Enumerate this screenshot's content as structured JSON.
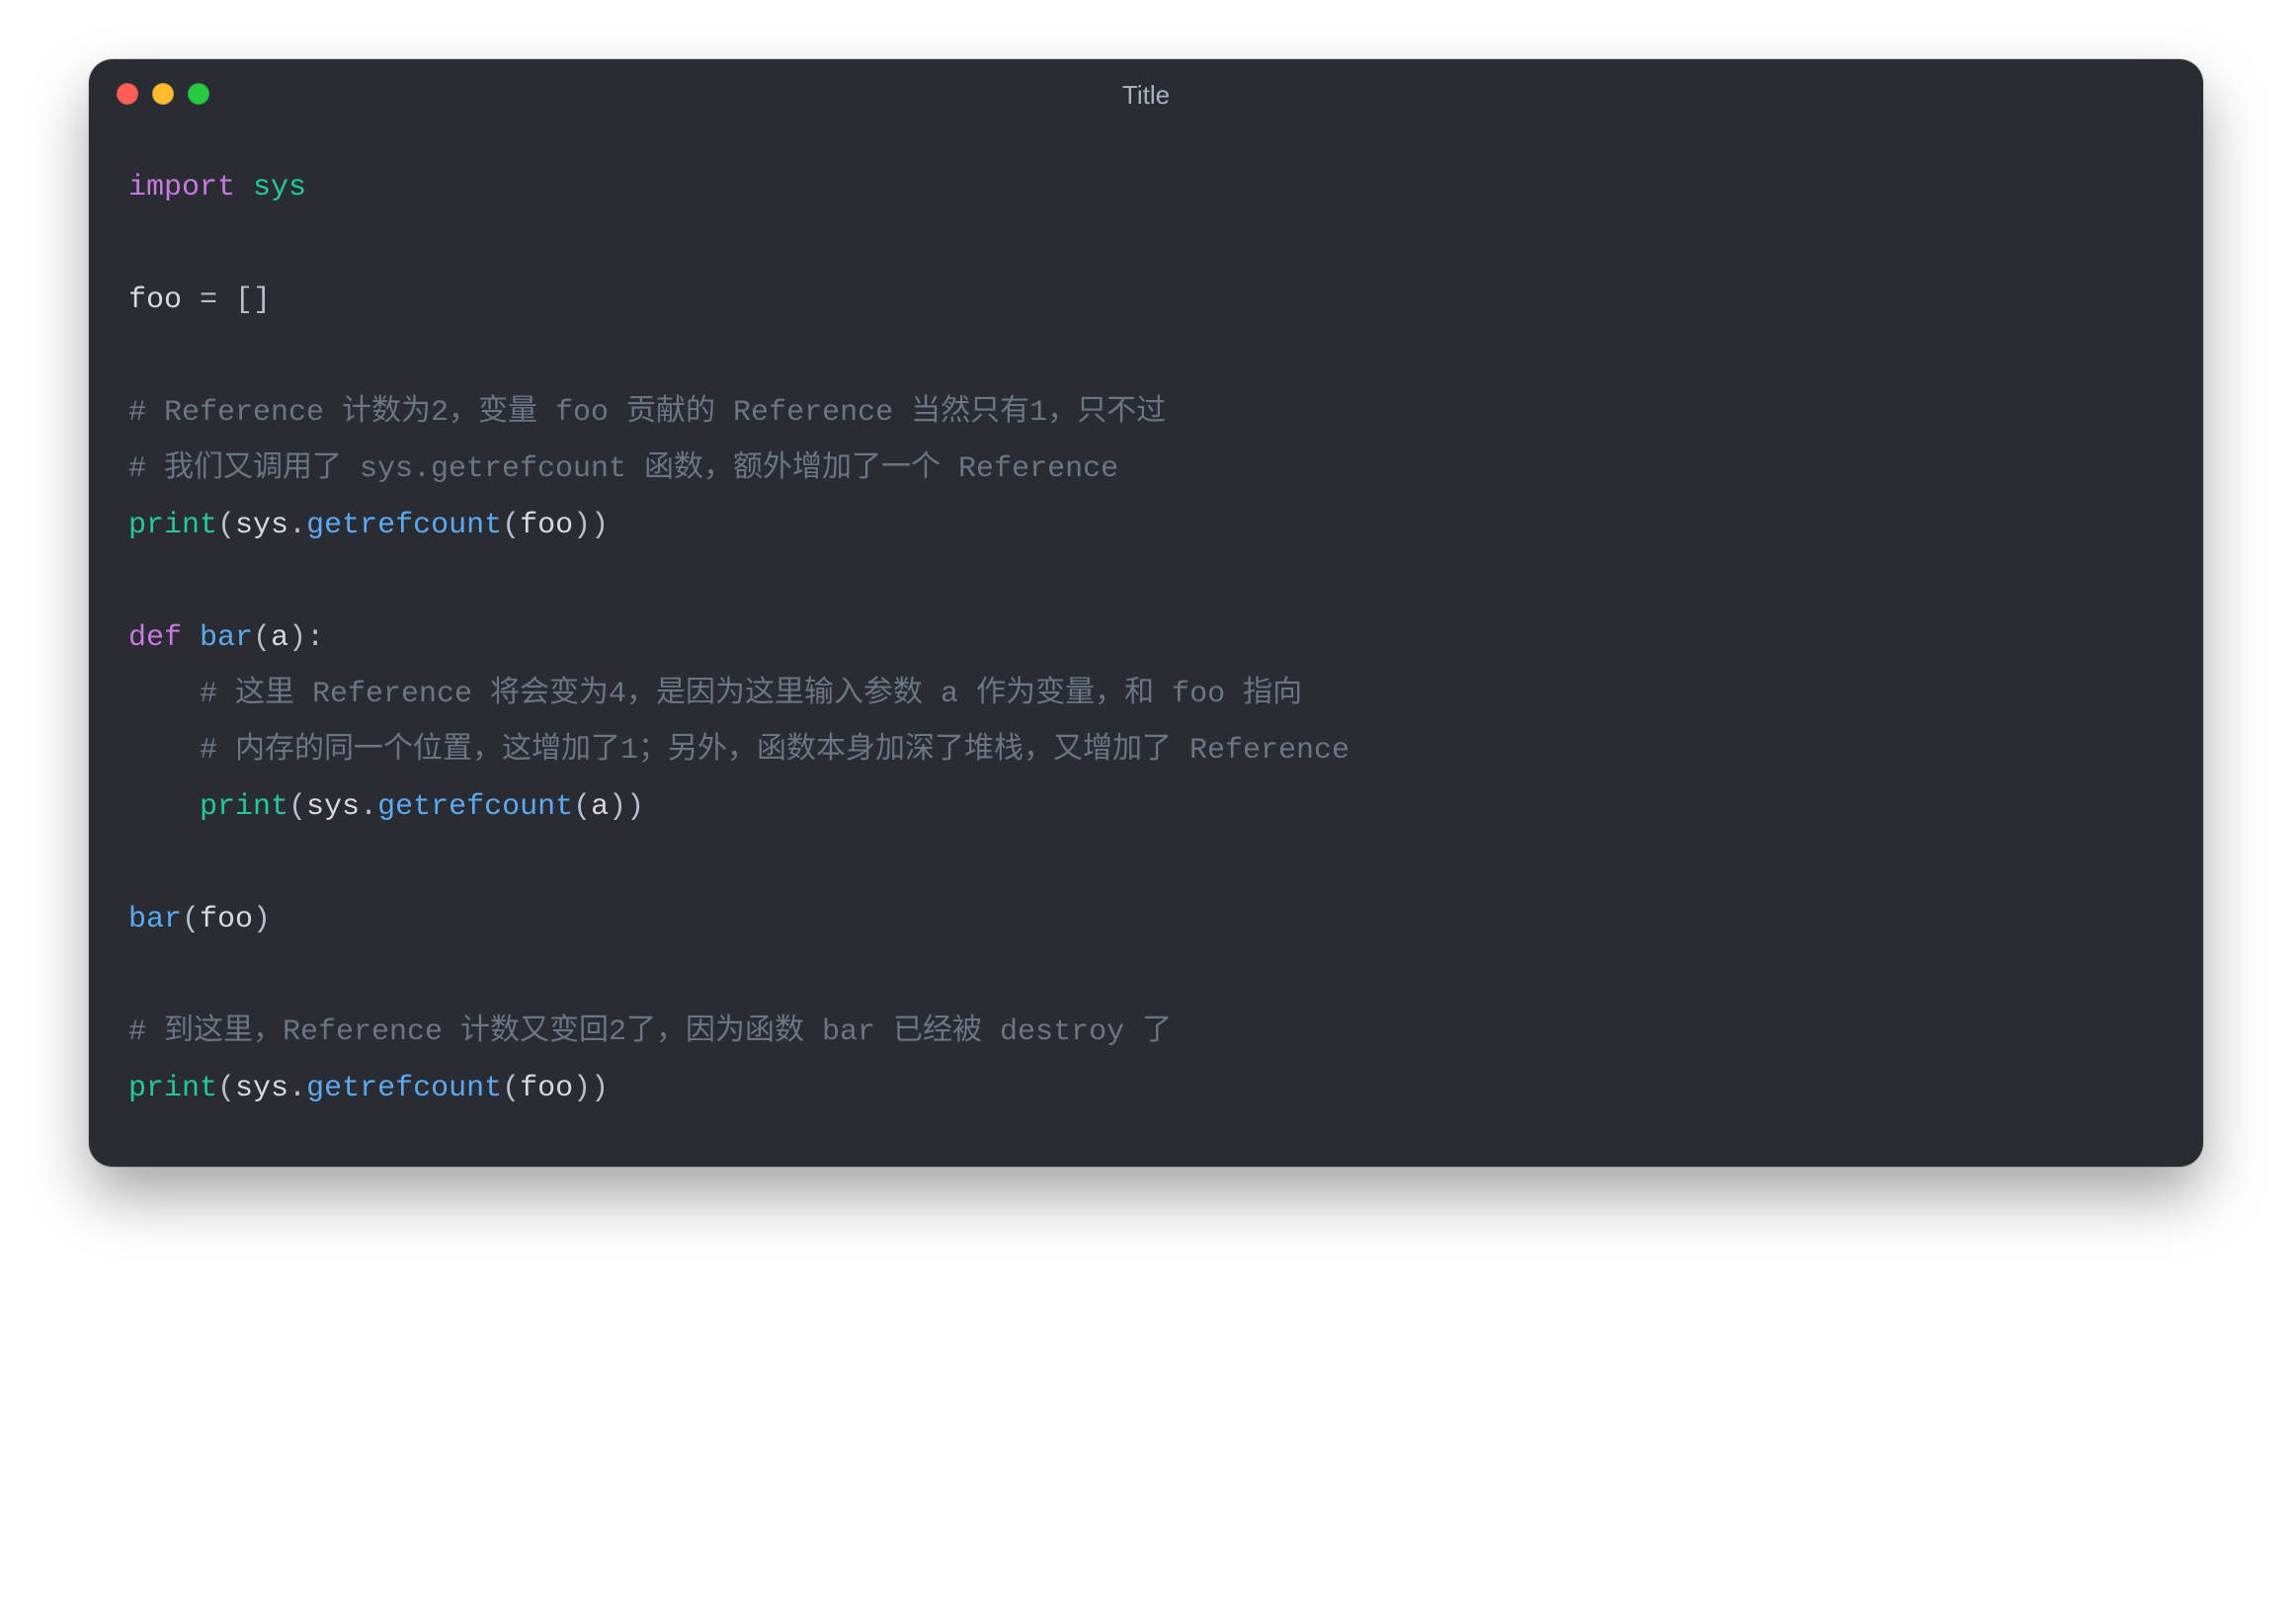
{
  "window": {
    "title": "Title"
  },
  "code": {
    "lines": [
      [
        {
          "cls": "kw",
          "t": "import"
        },
        {
          "cls": "pn",
          "t": " "
        },
        {
          "cls": "bi",
          "t": "sys"
        }
      ],
      [],
      [
        {
          "cls": "id",
          "t": "foo "
        },
        {
          "cls": "pn",
          "t": "="
        },
        {
          "cls": "id",
          "t": " "
        },
        {
          "cls": "pn",
          "t": "[]"
        }
      ],
      [],
      [
        {
          "cls": "cm",
          "t": "# Reference 计数为2，变量 foo 贡献的 Reference 当然只有1，只不过"
        }
      ],
      [
        {
          "cls": "cm",
          "t": "# 我们又调用了 sys.getrefcount 函数，额外增加了一个 Reference"
        }
      ],
      [
        {
          "cls": "bi",
          "t": "print"
        },
        {
          "cls": "pn",
          "t": "("
        },
        {
          "cls": "id",
          "t": "sys"
        },
        {
          "cls": "pn",
          "t": "."
        },
        {
          "cls": "fn",
          "t": "getrefcount"
        },
        {
          "cls": "pn",
          "t": "("
        },
        {
          "cls": "id",
          "t": "foo"
        },
        {
          "cls": "pn",
          "t": "))"
        }
      ],
      [],
      [
        {
          "cls": "kw",
          "t": "def"
        },
        {
          "cls": "id",
          "t": " "
        },
        {
          "cls": "fn",
          "t": "bar"
        },
        {
          "cls": "pn",
          "t": "("
        },
        {
          "cls": "id",
          "t": "a"
        },
        {
          "cls": "pn",
          "t": "):"
        }
      ],
      [
        {
          "cls": "id",
          "t": "    "
        },
        {
          "cls": "cm",
          "t": "# 这里 Reference 将会变为4，是因为这里输入参数 a 作为变量，和 foo 指向"
        }
      ],
      [
        {
          "cls": "id",
          "t": "    "
        },
        {
          "cls": "cm",
          "t": "# 内存的同一个位置，这增加了1；另外，函数本身加深了堆栈，又增加了 Reference"
        }
      ],
      [
        {
          "cls": "id",
          "t": "    "
        },
        {
          "cls": "bi",
          "t": "print"
        },
        {
          "cls": "pn",
          "t": "("
        },
        {
          "cls": "id",
          "t": "sys"
        },
        {
          "cls": "pn",
          "t": "."
        },
        {
          "cls": "fn",
          "t": "getrefcount"
        },
        {
          "cls": "pn",
          "t": "("
        },
        {
          "cls": "id",
          "t": "a"
        },
        {
          "cls": "pn",
          "t": "))"
        }
      ],
      [],
      [
        {
          "cls": "fn",
          "t": "bar"
        },
        {
          "cls": "pn",
          "t": "("
        },
        {
          "cls": "id",
          "t": "foo"
        },
        {
          "cls": "pn",
          "t": ")"
        }
      ],
      [],
      [
        {
          "cls": "cm",
          "t": "# 到这里，Reference 计数又变回2了，因为函数 bar 已经被 destroy 了"
        }
      ],
      [
        {
          "cls": "bi",
          "t": "print"
        },
        {
          "cls": "pn",
          "t": "("
        },
        {
          "cls": "id",
          "t": "sys"
        },
        {
          "cls": "pn",
          "t": "."
        },
        {
          "cls": "fn",
          "t": "getrefcount"
        },
        {
          "cls": "pn",
          "t": "("
        },
        {
          "cls": "id",
          "t": "foo"
        },
        {
          "cls": "pn",
          "t": "))"
        }
      ]
    ]
  }
}
